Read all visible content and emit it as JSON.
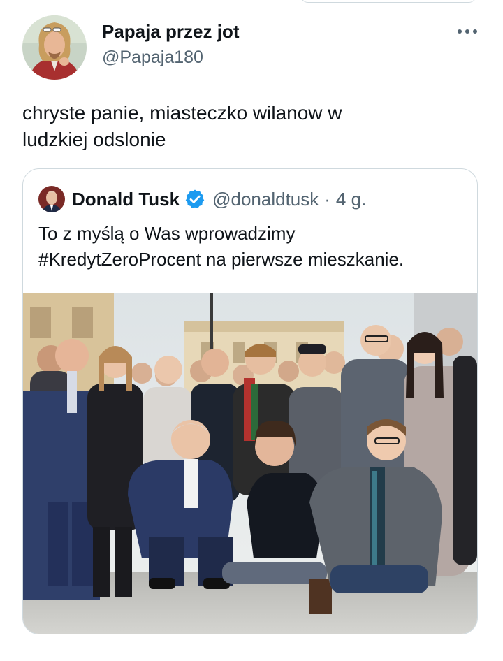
{
  "tweet": {
    "author_name": "Papaja przez jot",
    "author_handle": "@Papaja180",
    "text": "chryste panie, miasteczko wilanow w\nludzkiej odslonie",
    "more_icon": "more-horizontal-icon"
  },
  "quoted_tweet": {
    "author_name": "Donald Tusk",
    "verified_icon": "verified-badge-icon",
    "verified_color": "#1d9bf0",
    "handle": "@donaldtusk",
    "separator": "·",
    "time": "4 g.",
    "text": "To z myślą o Was wprowadzimy\n#KredytZeroProcent na pierwsze mieszkanie."
  },
  "colors": {
    "text": "#0f1419",
    "secondary": "#536471",
    "border": "#cfd9de"
  }
}
